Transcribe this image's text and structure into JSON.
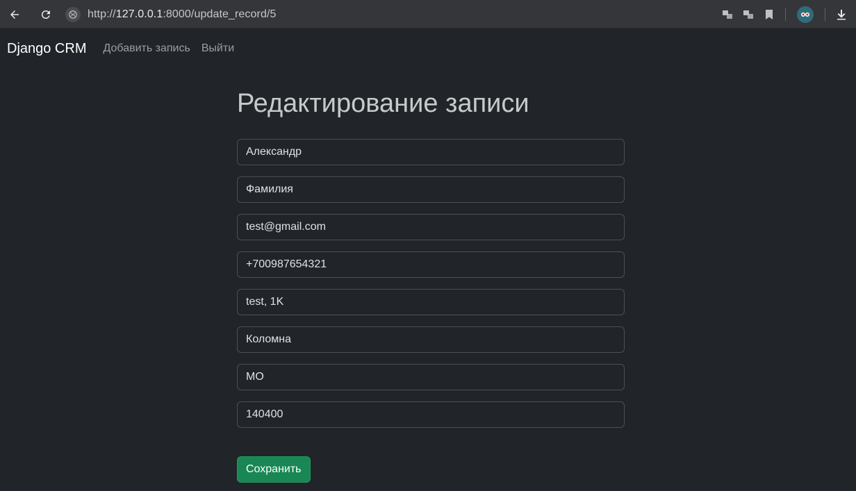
{
  "browser": {
    "url_prefix": "http://",
    "url_host": "127.0.0.1",
    "url_rest": ":8000/update_record/5",
    "icons": [
      "back-arrow-icon",
      "reload-icon",
      "site-info-icon",
      "translate-icon",
      "extension-icon",
      "bookmark-icon",
      "profile-avatar-icon",
      "download-icon"
    ]
  },
  "navbar": {
    "brand": "Django CRM",
    "links": [
      "Добавить запись",
      "Выйти"
    ]
  },
  "form": {
    "title": "Редактирование записи",
    "fields": [
      "Александр",
      "Фамилия",
      "test@gmail.com",
      "+700987654321",
      "test, 1K",
      "Коломна",
      "МО",
      "140400"
    ],
    "submit_label": "Сохранить"
  },
  "colors": {
    "background": "#212529",
    "submit": "#198754"
  }
}
